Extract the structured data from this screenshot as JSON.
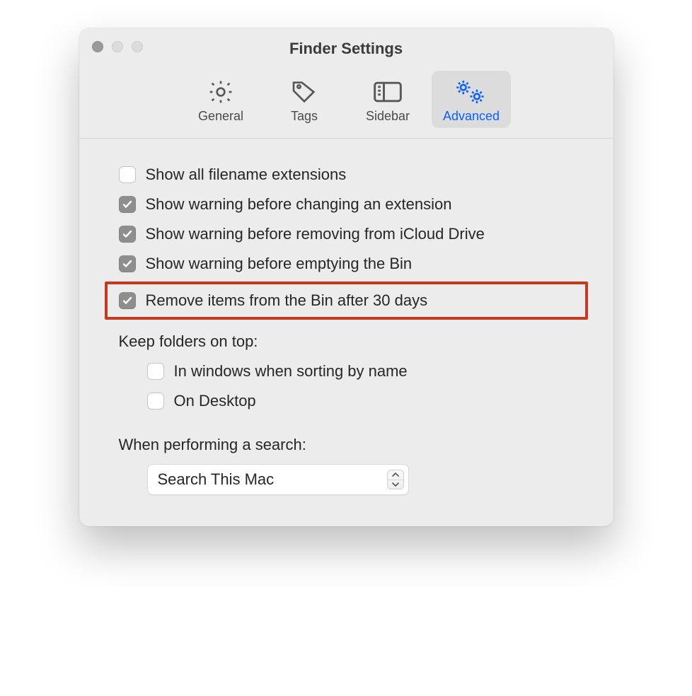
{
  "window": {
    "title": "Finder Settings"
  },
  "toolbar": {
    "general": "General",
    "tags": "Tags",
    "sidebar": "Sidebar",
    "advanced": "Advanced"
  },
  "options": {
    "show_extensions": "Show all filename extensions",
    "warn_extension": "Show warning before changing an extension",
    "warn_icloud": "Show warning before removing from iCloud Drive",
    "warn_bin": "Show warning before emptying the Bin",
    "remove_30": "Remove items from the Bin after 30 days"
  },
  "keep_folders": {
    "header": "Keep folders on top:",
    "in_windows": "In windows when sorting by name",
    "on_desktop": "On Desktop"
  },
  "search": {
    "header": "When performing a search:",
    "selected": "Search This Mac"
  }
}
